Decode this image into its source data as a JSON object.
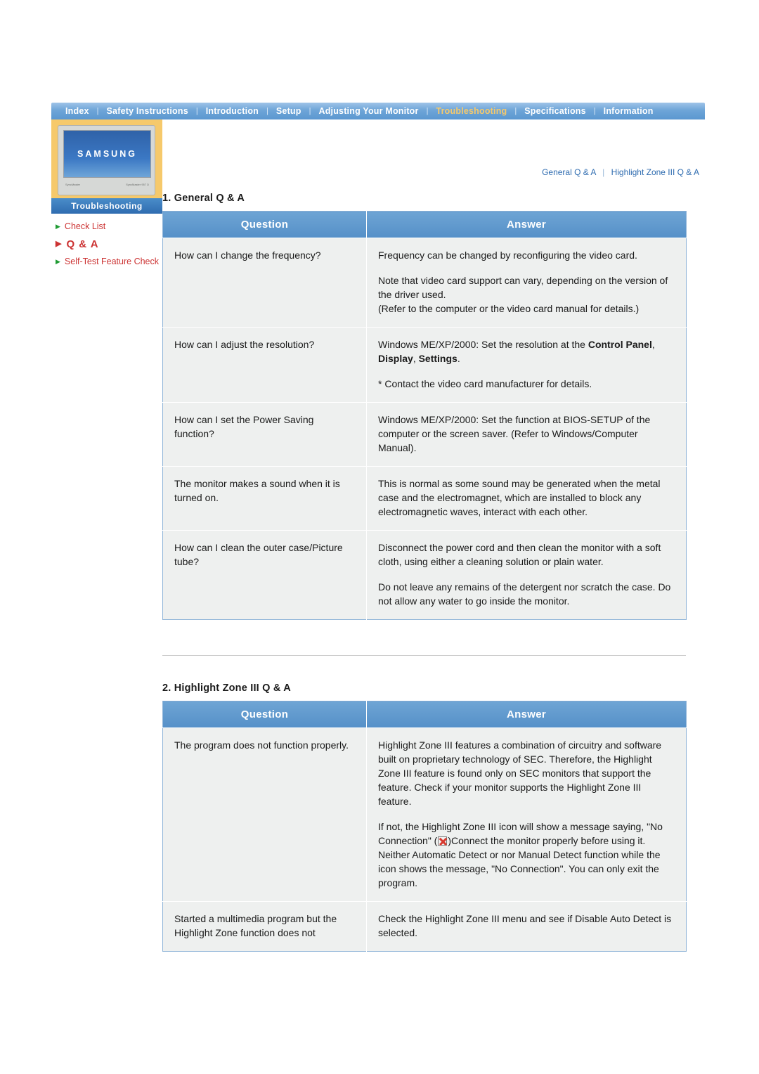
{
  "nav": {
    "items": [
      {
        "label": "Index",
        "active": false
      },
      {
        "label": "Safety Instructions",
        "active": false
      },
      {
        "label": "Introduction",
        "active": false
      },
      {
        "label": "Setup",
        "active": false
      },
      {
        "label": "Adjusting Your Monitor",
        "active": false
      },
      {
        "label": "Troubleshooting",
        "active": true
      },
      {
        "label": "Specifications",
        "active": false
      },
      {
        "label": "Information",
        "active": false
      }
    ]
  },
  "sidebar": {
    "logo_word": "SAMSUNG",
    "monitor_label_left": "SyncMaster",
    "monitor_label_right": "SyncMaster 957 D",
    "banner": "Troubleshooting",
    "items": [
      {
        "label": "Check List",
        "current": false
      },
      {
        "label": "Q & A",
        "current": true
      },
      {
        "label": "Self-Test Feature Check",
        "current": false
      }
    ]
  },
  "breadcrumb": {
    "first": "General Q & A",
    "second": "Highlight Zone III Q & A"
  },
  "sections": [
    {
      "title": "1. General Q & A",
      "headers": {
        "question": "Question",
        "answer": "Answer"
      },
      "rows": [
        {
          "question": [
            "How can I change the frequency?"
          ],
          "answer": [
            "Frequency can be changed by reconfiguring the video card.",
            "Note that video card support can vary, depending on the version of the driver used.",
            "(Refer to the computer or the video card manual for details.)"
          ]
        },
        {
          "question": [
            "How can I adjust the resolution?"
          ],
          "answer": [
            "Windows ME/XP/2000: Set the resolution at the Control Panel, Display, Settings.",
            "* Contact the video card manufacturer for details."
          ]
        },
        {
          "question": [
            "How can I set the Power Saving function?"
          ],
          "answer": [
            "Windows ME/XP/2000: Set the function at BIOS-SETUP of the computer or the screen saver. (Refer to Windows/Computer Manual)."
          ]
        },
        {
          "question": [
            "The monitor makes a sound when it is turned on."
          ],
          "answer": [
            "This is normal as some sound may be generated when the metal case and the electromagnet, which are installed to block any electromagnetic waves, interact with each other."
          ]
        },
        {
          "question": [
            "How can I clean the outer case/Picture tube?"
          ],
          "answer": [
            "Disconnect the power cord and then clean the monitor with a soft cloth, using either a cleaning solution or plain water.",
            "Do not leave any remains of the detergent nor scratch the case. Do not allow any water to go inside the monitor."
          ]
        }
      ]
    },
    {
      "title": "2. Highlight Zone III Q & A",
      "headers": {
        "question": "Question",
        "answer": "Answer"
      },
      "rows": [
        {
          "question": [
            "The program does not function properly."
          ],
          "answer": [
            "Highlight Zone III features a combination of circuitry and software built on proprietary technology of SEC. Therefore, the Highlight Zone III feature is found only on SEC monitors that support the feature. Check if your monitor supports the Highlight Zone III feature.",
            "If not, the Highlight Zone III icon will show a message saying, \"No Connection\" (  )Connect the monitor properly before using it. Neither Automatic Detect or nor Manual Detect function while the icon shows the message, \"No Connection\". You can only exit the program."
          ]
        },
        {
          "question": [
            "Started a multimedia program but the Highlight Zone function does not"
          ],
          "answer": [
            "Check the Highlight Zone III menu and see if Disable Auto Detect is selected."
          ]
        }
      ]
    }
  ]
}
